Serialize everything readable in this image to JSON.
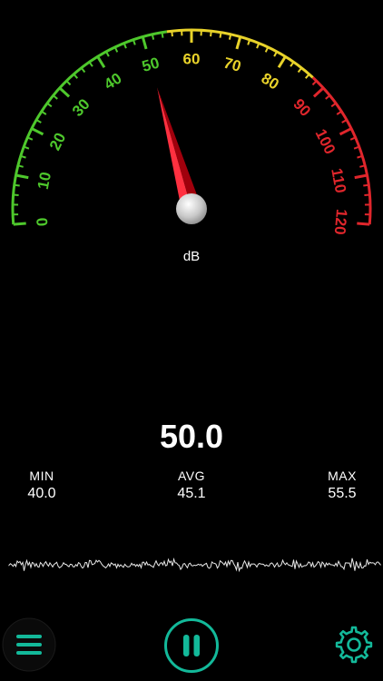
{
  "meter": {
    "unit": "dB",
    "current": "50.0",
    "needle_value": 50,
    "scale_labels": [
      "0",
      "10",
      "20",
      "30",
      "40",
      "50",
      "60",
      "70",
      "80",
      "90",
      "100",
      "110",
      "120"
    ],
    "scale_min": 0,
    "scale_max": 120
  },
  "stats": {
    "min_label": "MIN",
    "min_value": "40.0",
    "avg_label": "AVG",
    "avg_value": "45.1",
    "max_label": "MAX",
    "max_value": "55.5"
  },
  "colors": {
    "background": "#000000",
    "green": "#4ec82c",
    "yellow": "#e8d22a",
    "red": "#e0262c",
    "accent": "#13b99a",
    "needle": "#e8101e",
    "text": "#ffffff"
  },
  "icons": {
    "menu": "hamburger-menu-icon",
    "pause": "pause-icon",
    "settings": "gear-icon"
  }
}
